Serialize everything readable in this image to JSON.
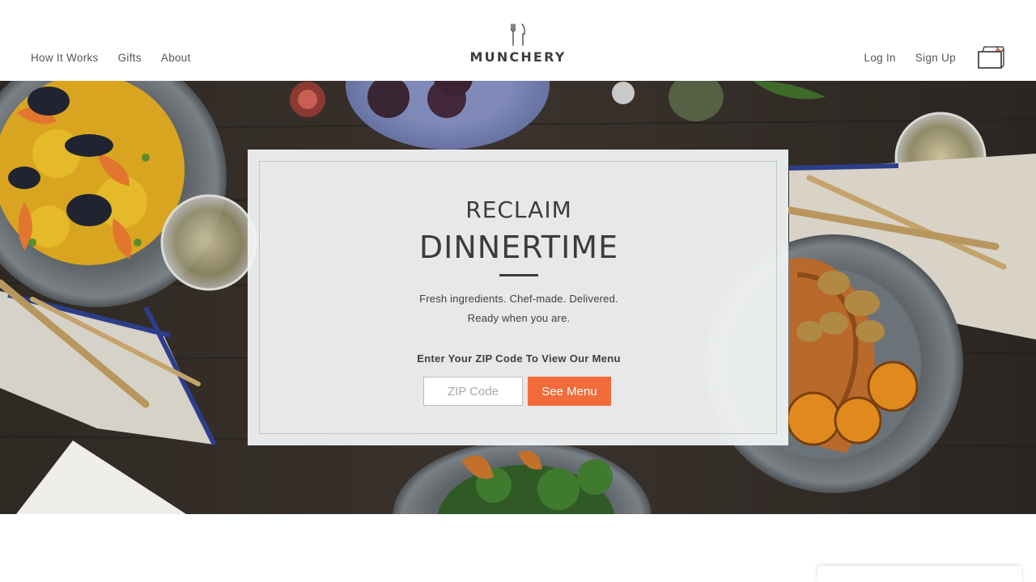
{
  "header": {
    "nav_left": [
      {
        "label": "How It Works"
      },
      {
        "label": "Gifts"
      },
      {
        "label": "About"
      }
    ],
    "logo": {
      "icon": "fork-and-knife-icon",
      "wordmark": "MUNCHERY"
    },
    "nav_right": [
      {
        "label": "Log In"
      },
      {
        "label": "Sign Up"
      }
    ],
    "cart_icon": "shopping-bag-icon"
  },
  "hero": {
    "headline_line1": "RECLAIM",
    "headline_line2": "DINNERTIME",
    "tagline_line1": "Fresh ingredients. Chef-made. Delivered.",
    "tagline_line2": "Ready when you are.",
    "zip_prompt": "Enter Your ZIP Code To View Our Menu",
    "zip_input": {
      "value": "",
      "placeholder": "ZIP Code"
    },
    "submit_label": "See Menu"
  },
  "colors": {
    "accent": "#f26b3a",
    "text": "#3c3c3c",
    "panel": "#f0f2f3"
  }
}
